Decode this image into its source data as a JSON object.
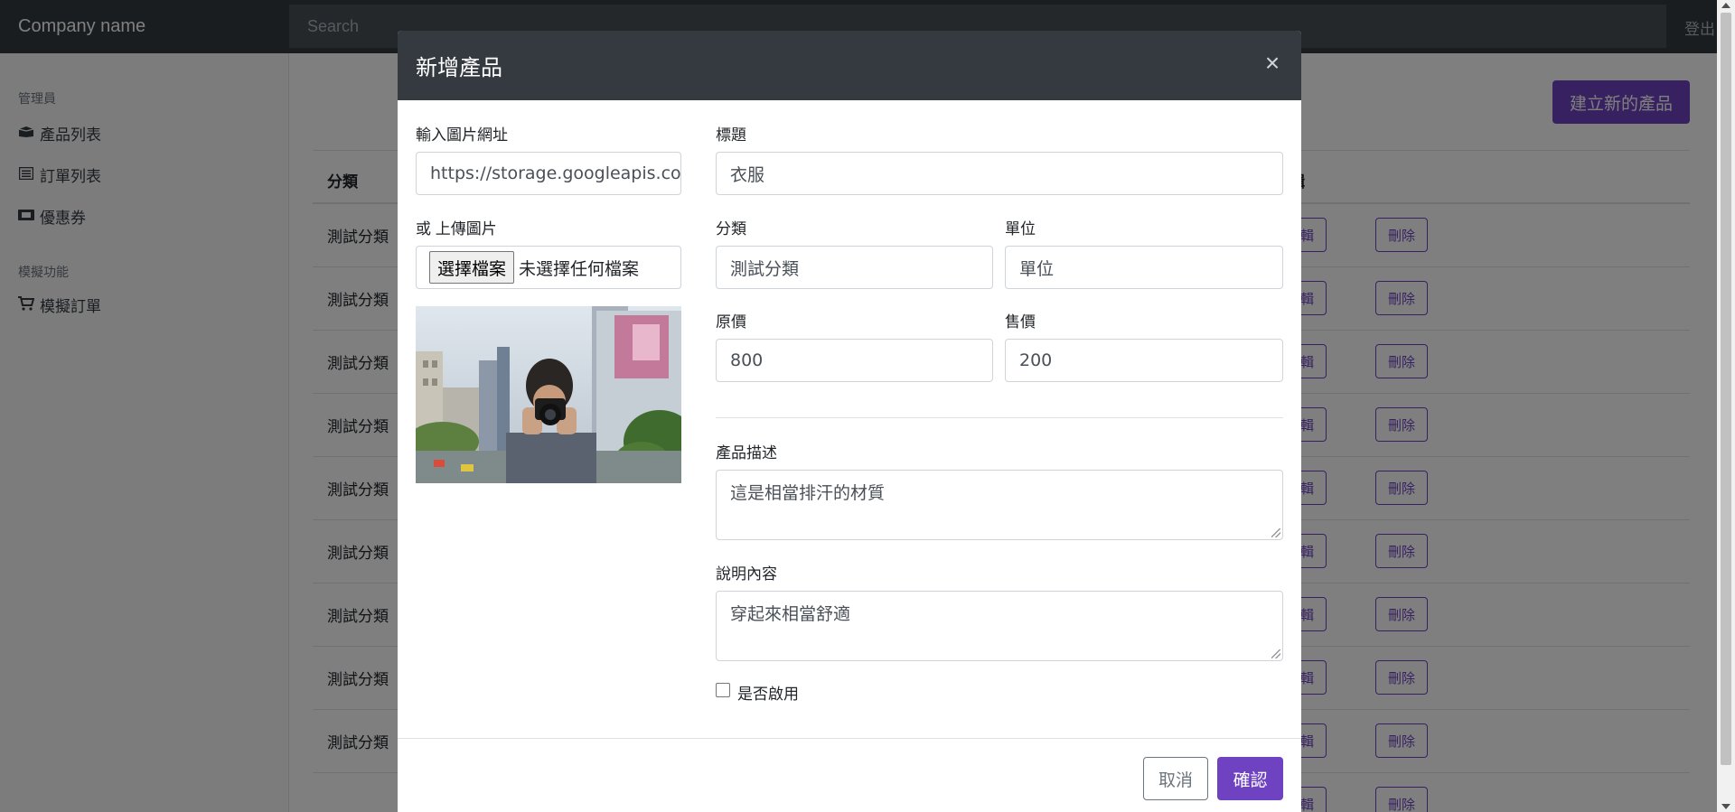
{
  "navbar": {
    "brand": "Company name",
    "search_placeholder": "Search",
    "logout": "登出"
  },
  "sidebar": {
    "admin_heading": "管理員",
    "admin_items": [
      {
        "label": "產品列表",
        "icon": "box-open-icon"
      },
      {
        "label": "訂單列表",
        "icon": "list-alt-icon"
      },
      {
        "label": "優惠券",
        "icon": "ticket-icon"
      }
    ],
    "mock_heading": "模擬功能",
    "mock_items": [
      {
        "label": "模擬訂單",
        "icon": "shopping-cart-icon"
      }
    ]
  },
  "main": {
    "create_button": "建立新的產品",
    "table": {
      "headers": {
        "category": "分類",
        "edit": "編輯"
      },
      "rows": [
        {
          "category": "測試分類",
          "edit": "編輯",
          "delete": "刪除"
        },
        {
          "category": "測試分類",
          "edit": "編輯",
          "delete": "刪除"
        },
        {
          "category": "測試分類",
          "edit": "編輯",
          "delete": "刪除"
        },
        {
          "category": "測試分類",
          "edit": "編輯",
          "delete": "刪除"
        },
        {
          "category": "測試分類",
          "edit": "編輯",
          "delete": "刪除"
        },
        {
          "category": "測試分類",
          "edit": "編輯",
          "delete": "刪除"
        },
        {
          "category": "測試分類",
          "edit": "編輯",
          "delete": "刪除"
        },
        {
          "category": "測試分類",
          "edit": "編輯",
          "delete": "刪除"
        },
        {
          "category": "測試分類",
          "edit": "編輯",
          "delete": "刪除"
        },
        {
          "category": "",
          "edit": "編輯",
          "delete": "刪除"
        }
      ]
    }
  },
  "modal": {
    "title": "新增產品",
    "close_symbol": "×",
    "image_url": {
      "label": "輸入圖片網址",
      "value": "https://storage.googleapis.com"
    },
    "upload": {
      "label": "或 上傳圖片",
      "button": "選擇檔案",
      "status": "未選擇任何檔案"
    },
    "title_field": {
      "label": "標題",
      "value": "衣服"
    },
    "category_field": {
      "label": "分類",
      "value": "測試分類"
    },
    "unit_field": {
      "label": "單位",
      "value": "單位"
    },
    "origin_price": {
      "label": "原價",
      "value": "800"
    },
    "price": {
      "label": "售價",
      "value": "200"
    },
    "description": {
      "label": "產品描述",
      "value": "這是相當排汗的材質"
    },
    "content": {
      "label": "說明內容",
      "value": "穿起來相當舒適"
    },
    "enabled": {
      "label": "是否啟用",
      "checked": false
    },
    "cancel": "取消",
    "confirm": "確認"
  },
  "colors": {
    "primary": "#6f42c1",
    "navbar": "#343a40",
    "secondary": "#6c757d"
  }
}
